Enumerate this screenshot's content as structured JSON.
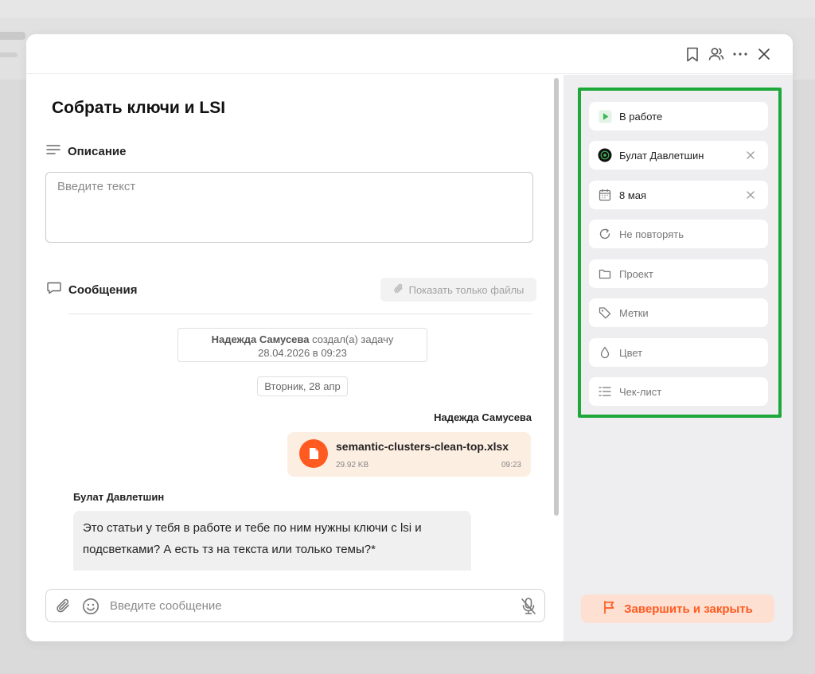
{
  "task": {
    "title": "Собрать ключи и LSI"
  },
  "description": {
    "label": "Описание",
    "placeholder": "Введите текст"
  },
  "messages": {
    "label": "Сообщения",
    "files_only_button": "Показать только файлы",
    "created_author": "Надежда Самусева",
    "created_action": "создал(а) задачу",
    "created_datetime": "28.04.2026 в 09:23",
    "date_separator": "Вторник, 28 апр",
    "file_message": {
      "sender": "Надежда Самусева",
      "file_name": "semantic-clusters-clean-top.xlsx",
      "file_size": "29.92 KB",
      "time": "09:23"
    },
    "text_message": {
      "sender": "Булат Давлетшин",
      "text": "Это статьи у тебя в работе и тебе по ним нужны ключи с lsi и подсветками? А есть тз на текста или только темы?*"
    }
  },
  "composer": {
    "placeholder": "Введите сообщение"
  },
  "properties": {
    "status": "В работе",
    "assignee": "Булат Давлетшин",
    "due_date": "8 мая",
    "repeat": "Не повторять",
    "project": "Проект",
    "tags": "Метки",
    "color": "Цвет",
    "checklist": "Чек-лист"
  },
  "actions": {
    "finish_close": "Завершить и закрыть"
  },
  "colors": {
    "accent": "#ff5a1f",
    "highlight_frame": "#1fa83a",
    "status_green": "#3fb55a"
  }
}
